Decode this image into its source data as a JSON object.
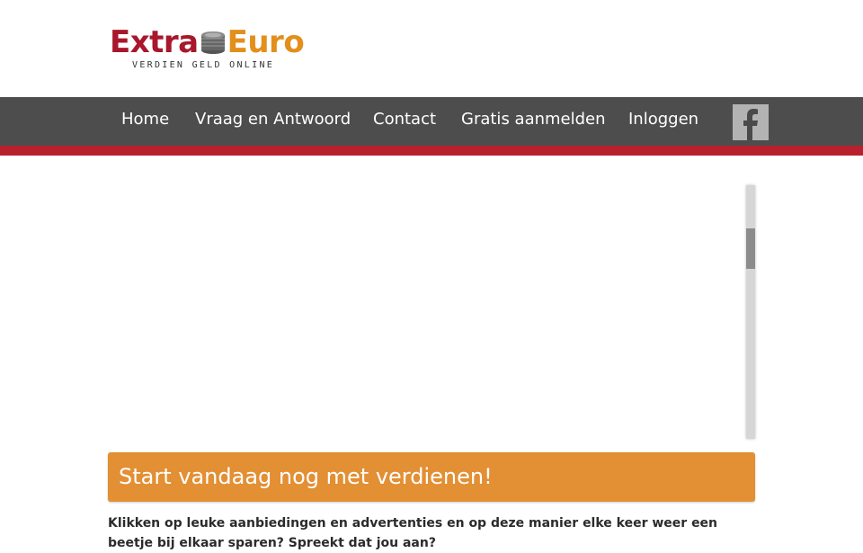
{
  "brand": {
    "name_part1": "Extra",
    "name_part2": "Euro",
    "tagline": "VERDIEN GELD ONLINE",
    "colors": {
      "part1": "#a8172b",
      "part2": "#e38f1c"
    }
  },
  "nav": {
    "items": [
      {
        "label": "Home"
      },
      {
        "label": "Vraag en Antwoord"
      },
      {
        "label": "Contact"
      },
      {
        "label": "Gratis aanmelden"
      },
      {
        "label": "Inloggen"
      }
    ],
    "social_icon": "facebook-icon",
    "colors": {
      "bar": "#4d4d4d",
      "accent": "#b8202e"
    }
  },
  "banner": {
    "title": "Start vandaag nog met verdienen!",
    "color": "#e38f33"
  },
  "intro": {
    "text": "Klikken op leuke aanbiedingen en advertenties en op deze manier elke keer weer een beetje bij elkaar sparen? Spreekt dat jou aan?"
  }
}
